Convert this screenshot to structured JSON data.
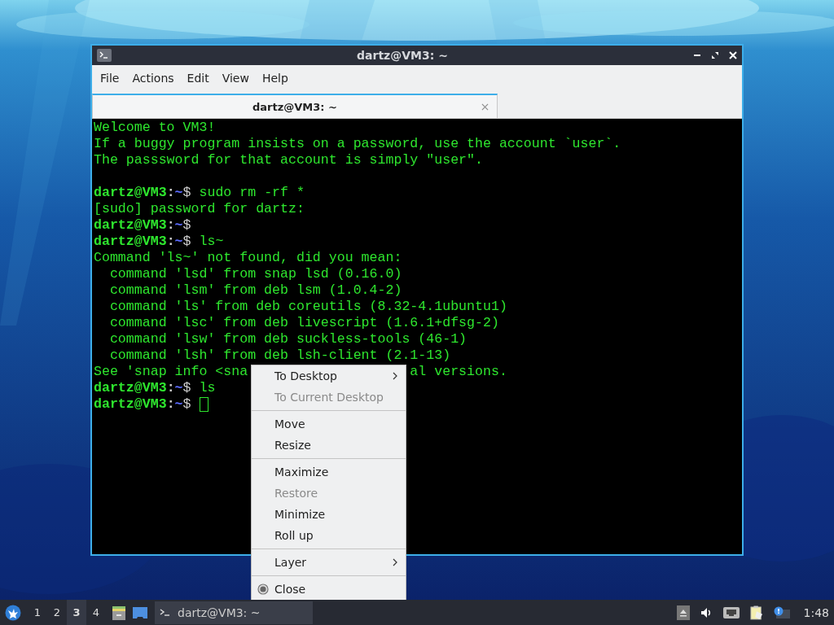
{
  "window": {
    "title": "dartz@VM3: ~"
  },
  "menubar": [
    "File",
    "Actions",
    "Edit",
    "View",
    "Help"
  ],
  "tabs": [
    {
      "label": "dartz@VM3: ~",
      "selected": true
    }
  ],
  "terminal": {
    "lines": [
      {
        "kind": "output",
        "text": "Welcome to VM3!"
      },
      {
        "kind": "output",
        "text": "If a buggy program insists on a password, use the account `user`."
      },
      {
        "kind": "output",
        "text": "The passsword for that account is simply \"user\"."
      },
      {
        "kind": "blank"
      },
      {
        "kind": "prompt",
        "prompt": [
          "dartz@VM3",
          ":",
          "~",
          "$"
        ],
        "command": "sudo rm -rf *"
      },
      {
        "kind": "output",
        "text": "[sudo] password for dartz:"
      },
      {
        "kind": "prompt",
        "prompt": [
          "dartz@VM3",
          ":",
          "~",
          "$"
        ]
      },
      {
        "kind": "prompt",
        "prompt": [
          "dartz@VM3",
          ":",
          "~",
          "$"
        ],
        "command": "ls~"
      },
      {
        "kind": "output",
        "text": "Command 'ls~' not found, did you mean:"
      },
      {
        "kind": "output",
        "text": "  command 'lsd' from snap lsd (0.16.0)"
      },
      {
        "kind": "output",
        "text": "  command 'lsm' from deb lsm (1.0.4-2)"
      },
      {
        "kind": "output",
        "text": "  command 'ls' from deb coreutils (8.32-4.1ubuntu1)"
      },
      {
        "kind": "output",
        "text": "  command 'lsc' from deb livescript (1.6.1+dfsg-2)"
      },
      {
        "kind": "output",
        "text": "  command 'lsw' from deb suckless-tools (46-1)"
      },
      {
        "kind": "output",
        "text": "  command 'lsh' from deb lsh-client (2.1-13)"
      },
      {
        "kind": "covered",
        "before": "See 'snap info <sna",
        "after": "al versions."
      },
      {
        "kind": "prompt",
        "prompt": [
          "dartz@VM3",
          ":",
          "~",
          "$"
        ],
        "command": "ls"
      },
      {
        "kind": "prompt",
        "prompt": [
          "dartz@VM3",
          ":",
          "~",
          "$"
        ],
        "cursor": true
      }
    ]
  },
  "context_menu": {
    "groups": [
      [
        {
          "label": "To Desktop",
          "kind": "submenu",
          "disabled": false
        },
        {
          "label": "To Current Desktop",
          "kind": "plain",
          "disabled": true
        }
      ],
      [
        {
          "label": "Move",
          "kind": "plain",
          "disabled": false
        },
        {
          "label": "Resize",
          "kind": "plain",
          "disabled": false
        }
      ],
      [
        {
          "label": "Maximize",
          "kind": "plain",
          "disabled": false
        },
        {
          "label": "Restore",
          "kind": "plain",
          "disabled": true
        },
        {
          "label": "Minimize",
          "kind": "plain",
          "disabled": false
        },
        {
          "label": "Roll up",
          "kind": "plain",
          "disabled": false
        }
      ],
      [
        {
          "label": "Layer",
          "kind": "submenu",
          "disabled": false
        }
      ],
      [
        {
          "label": "Close",
          "kind": "icon",
          "disabled": false
        }
      ]
    ]
  },
  "taskbar": {
    "workspaces": [
      {
        "label": "1",
        "selected": false
      },
      {
        "label": "2",
        "selected": false
      },
      {
        "label": "3",
        "selected": true
      },
      {
        "label": "4",
        "selected": false
      }
    ],
    "tasks": [
      {
        "label": "dartz@VM3: ~"
      }
    ],
    "clock": "1:48"
  }
}
